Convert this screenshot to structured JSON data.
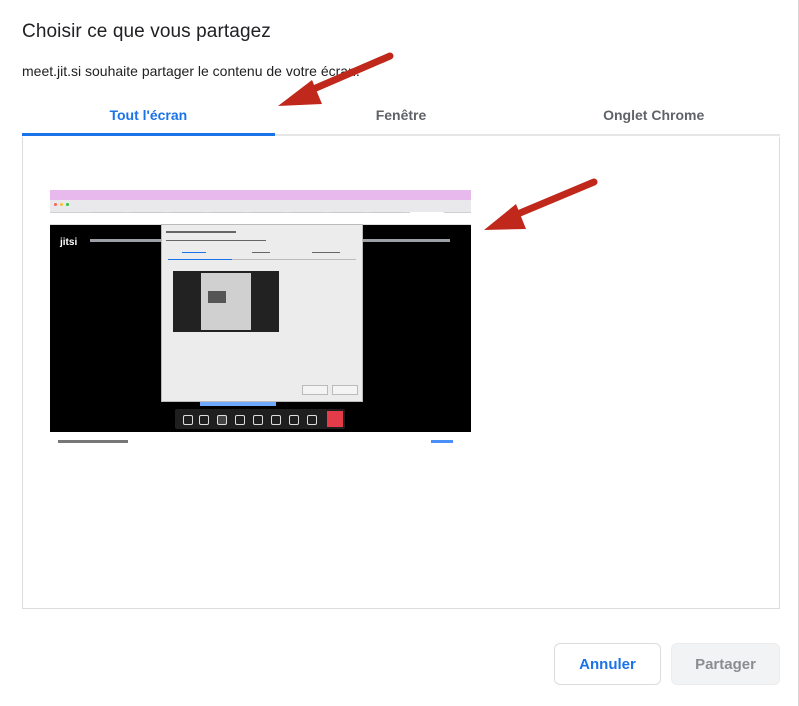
{
  "dialog": {
    "title": "Choisir ce que vous partagez",
    "subtitle": "meet.jit.si souhaite partager le contenu de votre écran."
  },
  "tabs": [
    {
      "label": "Tout l'écran",
      "active": true
    },
    {
      "label": "Fenêtre",
      "active": false
    },
    {
      "label": "Onglet Chrome",
      "active": false
    }
  ],
  "preview": {
    "logo_text": "jitsi"
  },
  "buttons": {
    "cancel_label": "Annuler",
    "share_label": "Partager"
  },
  "colors": {
    "accent": "#1a73e8",
    "annotation_arrow": "#c0281c"
  },
  "annotations": [
    {
      "icon": "red-arrow-icon",
      "points_to": "Tout l'écran tab"
    },
    {
      "icon": "red-arrow-icon",
      "points_to": "screen preview thumbnail"
    }
  ]
}
